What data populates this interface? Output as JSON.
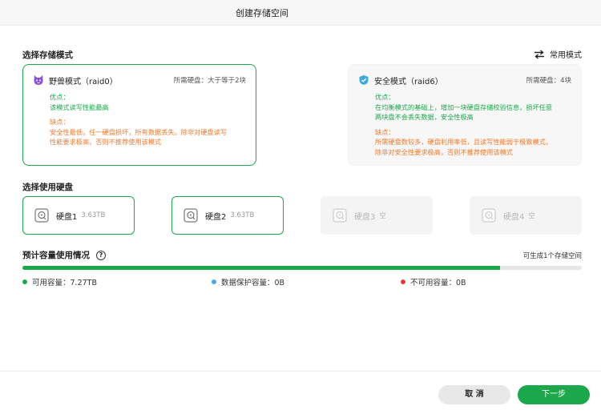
{
  "window": {
    "title": "创建存储空间"
  },
  "storage_mode": {
    "section_title": "选择存储模式",
    "switch_label": "常用模式",
    "modes": [
      {
        "name": "野兽模式（raid0）",
        "requirement": "所需硬盘：大于等于2块",
        "pros_title": "优点：",
        "pros": "该模式读写性能最高",
        "cons_title": "缺点：",
        "cons_lines": [
          "安全性最低，任一硬盘损坏，所有数据丢失。除非对硬盘读写",
          "性能要求极高，否则不推荐使用该模式"
        ],
        "selected": true
      },
      {
        "name": "安全模式（raid6）",
        "requirement": "所需硬盘：4块",
        "pros_title": "优点：",
        "pros_lines": [
          "在均衡模式的基础上，增加一块硬盘存储校验信息，损坏任意",
          "两块盘不会丢失数据，安全性极高"
        ],
        "cons_title": "缺点：",
        "cons_lines": [
          "所需硬盘数较多，硬盘利用率低，且读写性能弱于极致模式，",
          "除非对安全性要求极高，否则不推荐使用该模式"
        ],
        "selected": false
      }
    ]
  },
  "disks": {
    "section_title": "选择使用硬盘",
    "items": [
      {
        "name": "硬盘1",
        "size": "3.63TB",
        "selected": true
      },
      {
        "name": "硬盘2",
        "size": "3.63TB",
        "selected": true
      },
      {
        "name": "硬盘3",
        "size": "空",
        "selected": false
      },
      {
        "name": "硬盘4",
        "size": "空",
        "selected": false
      }
    ]
  },
  "capacity": {
    "section_title": "预计容量使用情况",
    "help": "?",
    "summary": "可生成1个存储空间",
    "used_fraction": 0.854,
    "legend": [
      {
        "label": "可用容量：7.27TB",
        "color": "#1aa84a"
      },
      {
        "label": "数据保护容量：0B",
        "color": "#3fb0e6"
      },
      {
        "label": "不可用容量：0B",
        "color": "#e53935"
      }
    ]
  },
  "footer": {
    "cancel_label": "取 消",
    "next_label": "下一步"
  },
  "colors": {
    "accent": "#1aa84a",
    "warning": "#f07a2a"
  },
  "icons": [
    "swap-icon",
    "beast-mode-icon",
    "shield-icon",
    "disk-icon",
    "help-icon"
  ]
}
